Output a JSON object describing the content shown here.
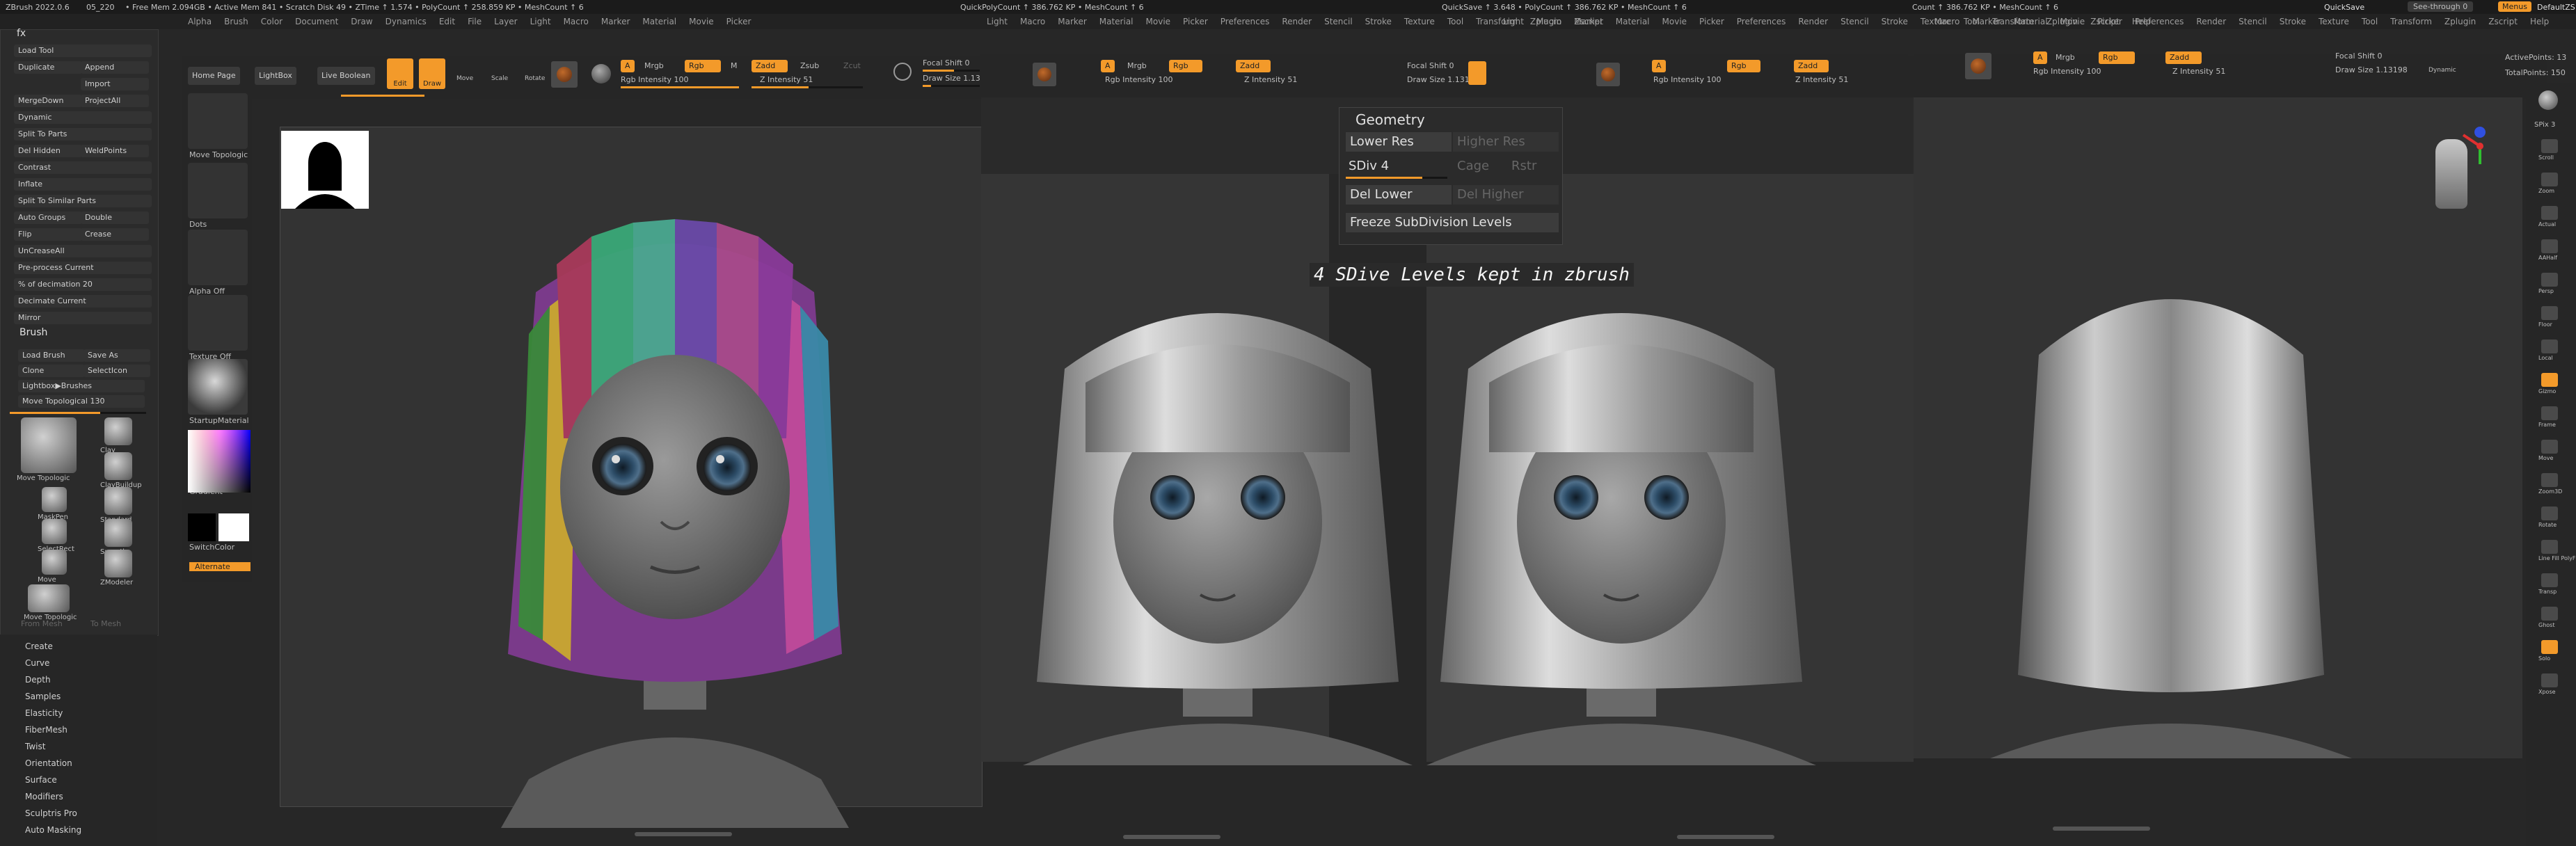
{
  "app": {
    "title": "ZBrush 2022.0.6",
    "doc": "05_220",
    "status": "• Free Mem 2.094GB • Active Mem 841 • Scratch Disk 49 • ZTime ↑ 1.574 • PolyCount ↑ 258.859 KP • MeshCount ↑ 6",
    "quicksave": "QuickSave",
    "see_through": "See-through  0",
    "menus_label": "Menus",
    "default_label": "DefaultZS"
  },
  "mid_status": [
    "QuickPolyCount ↑ 386.762 KP • MeshCount ↑ 6",
    "QuickSave ↑ 3.648 • PolyCount ↑ 386.762 KP • MeshCount ↑ 6",
    "Count ↑ 386.762 KP • MeshCount ↑ 6"
  ],
  "menubar": [
    "Alpha",
    "Brush",
    "Color",
    "Document",
    "Draw",
    "Dynamics",
    "Edit",
    "File",
    "Layer",
    "Light",
    "Macro",
    "Marker",
    "Material",
    "Movie",
    "Picker",
    "Preferences",
    "Render",
    "Stencil",
    "Stroke",
    "Texture",
    "Tool",
    "Transform",
    "Zplugin",
    "Zscript",
    "Help"
  ],
  "toolbar": {
    "home": "Home Page",
    "lightbox": "LightBox",
    "live_boolean": "Live Boolean",
    "edit": "Edit",
    "draw": "Draw",
    "move": "Move",
    "scale": "Scale",
    "rotate": "Rotate",
    "a": "A",
    "mrgb": "Mrgb",
    "rgb": "Rgb",
    "m": "M",
    "zadd": "Zadd",
    "zsub": "Zsub",
    "zcut": "Zcut",
    "rgb_intensity": "Rgb Intensity 100",
    "z_intensity": "Z Intensity 51",
    "focal_shift": "Focal Shift 0",
    "draw_size": "Draw Size 1.13198",
    "dynamic": "Dynamic"
  },
  "left_panel": {
    "header": "fx",
    "rows": [
      [
        "Load Tool",
        ""
      ],
      [
        "Duplicate",
        "Append"
      ],
      [
        "",
        "Import"
      ],
      [
        "MergeDown",
        "ProjectAll"
      ],
      [
        "Dynamic",
        ""
      ],
      [
        "Split To Parts",
        ""
      ],
      [
        "Del Hidden",
        "WeldPoints"
      ],
      [
        "Contrast",
        ""
      ],
      [
        "Inflate",
        ""
      ],
      [
        "Split To Similar Parts",
        ""
      ],
      [
        "Auto Groups",
        "Double"
      ],
      [
        "Flip",
        "Crease"
      ],
      [
        "UnCreaseAll",
        ""
      ],
      [
        "Pre-process Current",
        ""
      ],
      [
        "% of decimation 20",
        ""
      ],
      [
        "Decimate Current",
        ""
      ],
      [
        "Mirror",
        ""
      ]
    ],
    "brush_header": "Brush",
    "brush_rows": [
      [
        "Load Brush",
        "Save As"
      ],
      [
        "Clone",
        "SelectIcon"
      ],
      [
        "Lightbox▶Brushes",
        ""
      ],
      [
        "Move Topological 130",
        ""
      ]
    ],
    "brushes": [
      "Move Topologic",
      "Clay",
      "ClayBuildup",
      "MaskPen",
      "Standard",
      "SelectRect",
      "Smooth",
      "Move",
      "ZModeler",
      "Move Topologic"
    ],
    "from_mesh": "From Mesh",
    "to_mesh": "To Mesh",
    "subpalettes": [
      "Create",
      "Curve",
      "Depth",
      "Samples",
      "Elasticity",
      "FiberMesh",
      "Twist",
      "Orientation",
      "Surface",
      "Modifiers",
      "Sculptris Pro",
      "Auto Masking"
    ]
  },
  "shelf": {
    "items": [
      "Move Topologic",
      "Dots",
      "Alpha Off",
      "Texture Off",
      "StartupMaterial",
      "Gradient",
      "SwitchColor",
      "Alternate"
    ]
  },
  "geometry_panel": {
    "title": "Geometry",
    "lower_res": "Lower Res",
    "higher_res": "Higher Res",
    "sdiv": "SDiv 4",
    "cage": "Cage",
    "rstr": "Rstr",
    "del_lower": "Del Lower",
    "del_higher": "Del Higher",
    "freeze": "Freeze SubDivision Levels",
    "sdiv_level": 0.75
  },
  "annotation": "4 SDive Levels kept in zbrush",
  "right_tray": {
    "active_points": "ActivePoints: 13",
    "total_points": "TotalPoints: 150",
    "spix": "SPix 3",
    "items": [
      "Scroll",
      "Zoom",
      "Actual",
      "AAHalf",
      "Persp",
      "Floor",
      "Local",
      "Gizmo",
      "Frame",
      "Move",
      "Zoom3D",
      "Rotate",
      "Line Fill PolyF",
      "Transp",
      "Ghost",
      "Solo",
      "Xpose"
    ]
  },
  "colors": {
    "accent": "#f39a2a",
    "background": "#272727",
    "panel": "#2b2b2b",
    "viewport": "#333333"
  }
}
